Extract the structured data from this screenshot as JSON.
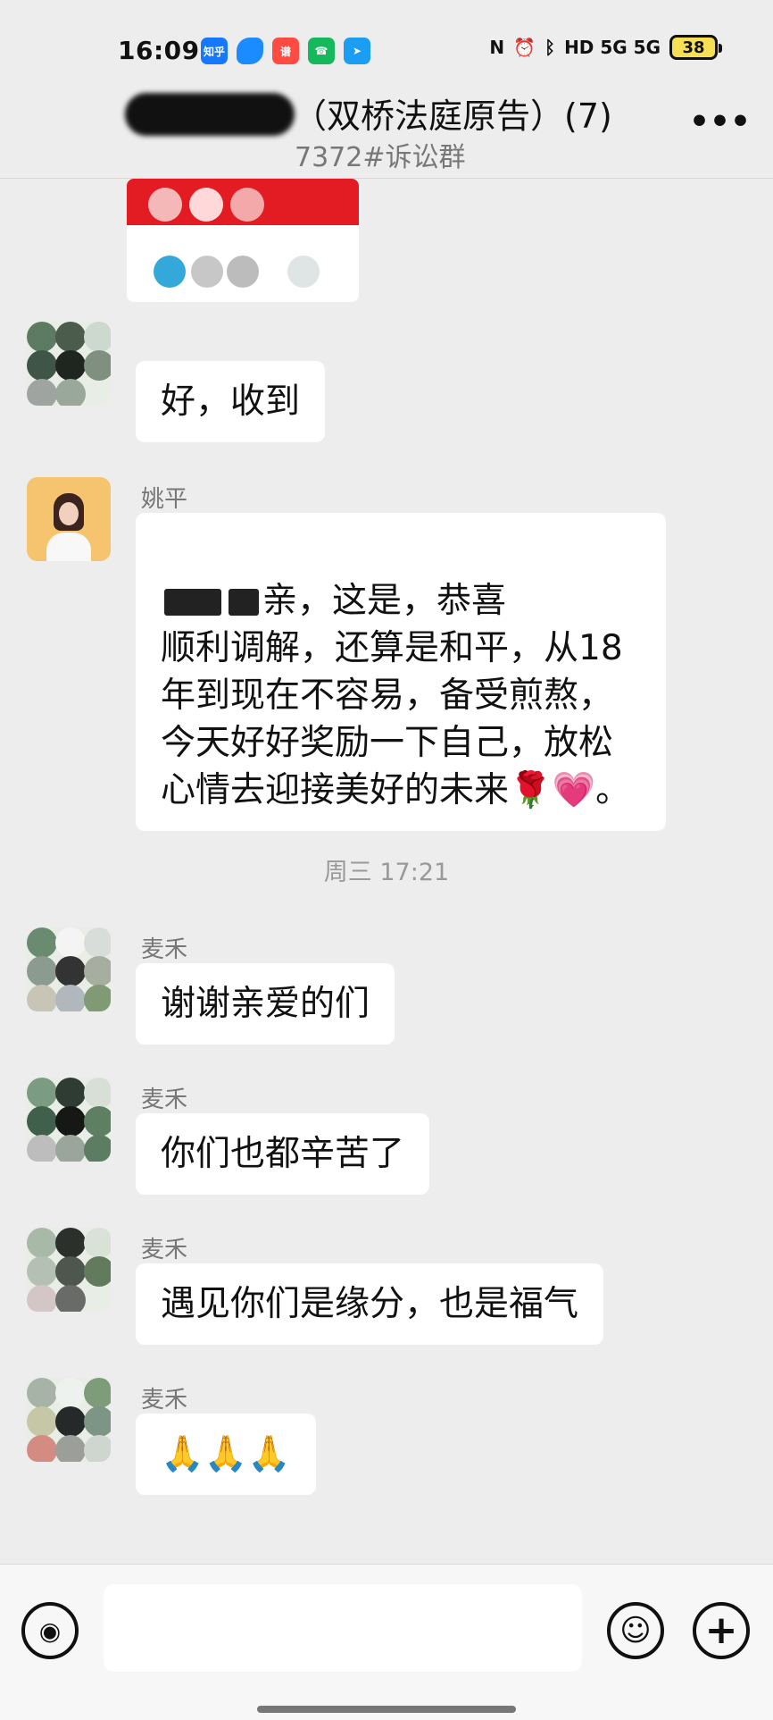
{
  "status": {
    "time": "16:09",
    "apps": [
      "知乎",
      "",
      "谱",
      "",
      ""
    ],
    "network": "HD 5G 5G",
    "battery": "38"
  },
  "header": {
    "title": "（双桥法庭原告）(7)",
    "subtitle": "7372#诉讼群",
    "more": "•••"
  },
  "messages": {
    "m1": {
      "text": "好，收到"
    },
    "m2": {
      "name": "姚平",
      "text": "亲，这是，恭喜\n顺利调解，还算是和平，从18\n年到现在不容易，备受煎熬，\n今天好好奖励一下自己，放松\n心情去迎接美好的未来🌹💗。"
    },
    "timestamp": "周三 17:21",
    "m3": {
      "name": "麦禾",
      "text": "谢谢亲爱的们"
    },
    "m4": {
      "name": "麦禾",
      "text": "你们也都辛苦了"
    },
    "m5": {
      "name": "麦禾",
      "text": "遇见你们是缘分，也是福气"
    },
    "m6": {
      "name": "麦禾",
      "text": "🙏🙏🙏"
    }
  },
  "input": {
    "voice": "◉",
    "emoji": "☺",
    "plus": "+"
  },
  "colors": {
    "background": "#ededed",
    "bubble": "#ffffff",
    "meta": "#777777"
  }
}
